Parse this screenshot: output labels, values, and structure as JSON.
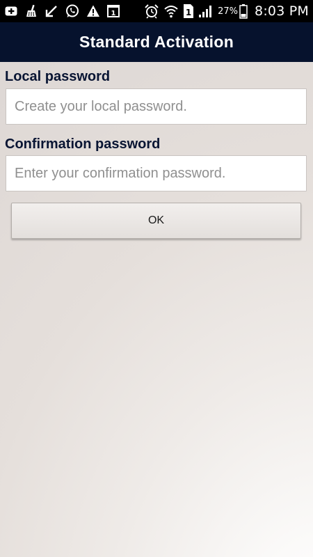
{
  "status_bar": {
    "left_icons": [
      "add-box-icon",
      "broom-icon",
      "missed-call-icon",
      "whatsapp-icon",
      "warning-icon",
      "calendar-icon"
    ],
    "calendar_day": "1",
    "right_icons": [
      "alarm-icon",
      "wifi-icon",
      "sim-icon",
      "signal-icon",
      "battery-icon"
    ],
    "sim_slot": "1",
    "battery_percent": "27%",
    "time": "8:03 PM"
  },
  "header": {
    "title": "Standard Activation",
    "background_color": "#06122d"
  },
  "form": {
    "local_password": {
      "label": "Local password",
      "placeholder": "Create your local password.",
      "value": ""
    },
    "confirmation_password": {
      "label": "Confirmation password",
      "placeholder": "Enter your confirmation password.",
      "value": ""
    },
    "ok_label": "OK"
  },
  "colors": {
    "label_text": "#091533",
    "placeholder_text": "#8f8f8f"
  }
}
